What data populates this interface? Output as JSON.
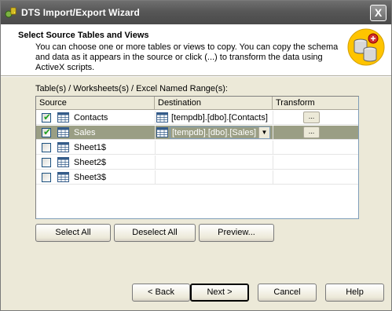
{
  "window": {
    "title": "DTS Import/Export Wizard",
    "close_label": "X"
  },
  "header": {
    "title": "Select Source Tables and Views",
    "description": "You can choose one or more tables or views to copy.  You can copy the schema and data as it appears in the source or click (...) to transform the data using ActiveX scripts.",
    "icon": "database-cylinders-icon"
  },
  "table_label": "Table(s) / Worksheets(s) / Excel Named Range(s):",
  "grid": {
    "columns": [
      "Source",
      "Destination",
      "Transform"
    ],
    "rows": [
      {
        "checked": true,
        "source": "Contacts",
        "destination": "[tempdb].[dbo].[Contacts]",
        "transform": "...",
        "selected": false
      },
      {
        "checked": true,
        "source": "Sales",
        "destination": "[tempdb].[dbo].[Sales]",
        "transform": "...",
        "selected": true
      },
      {
        "checked": false,
        "source": "Sheet1$",
        "destination": "",
        "transform": "",
        "selected": false
      },
      {
        "checked": false,
        "source": "Sheet2$",
        "destination": "",
        "transform": "",
        "selected": false
      },
      {
        "checked": false,
        "source": "Sheet3$",
        "destination": "",
        "transform": "",
        "selected": false
      }
    ]
  },
  "actions": {
    "select_all": "Select All",
    "deselect_all": "Deselect All",
    "preview": "Preview..."
  },
  "nav": {
    "back": "< Back",
    "next": "Next >",
    "cancel": "Cancel",
    "help": "Help"
  },
  "colors": {
    "selected_row": "#9a9e84",
    "titlebar": "#575757",
    "face": "#ECE9D8"
  }
}
